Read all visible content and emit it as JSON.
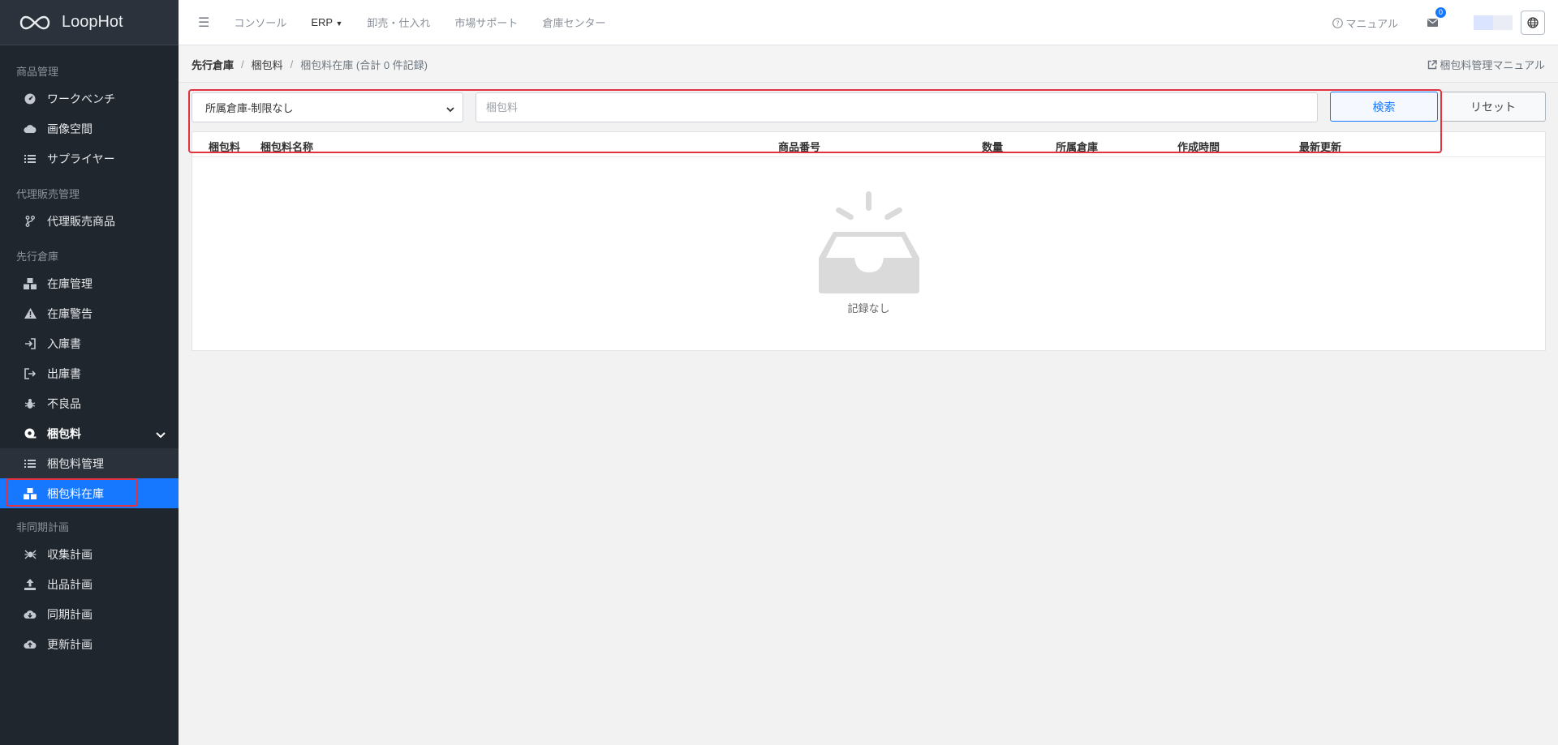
{
  "brand": {
    "name": "LoopHot"
  },
  "sidebar": {
    "sections": [
      {
        "header": "商品管理",
        "items": [
          {
            "label": "ワークベンチ",
            "icon": "dashboard-icon"
          },
          {
            "label": "画像空間",
            "icon": "cloud-icon"
          },
          {
            "label": "サプライヤー",
            "icon": "list-icon"
          }
        ]
      },
      {
        "header": "代理販売管理",
        "items": [
          {
            "label": "代理販売商品",
            "icon": "branch-icon"
          }
        ]
      },
      {
        "header": "先行倉庫",
        "items": [
          {
            "label": "在庫管理",
            "icon": "boxes-icon"
          },
          {
            "label": "在庫警告",
            "icon": "warning-icon"
          },
          {
            "label": "入庫書",
            "icon": "sign-in-icon"
          },
          {
            "label": "出庫書",
            "icon": "sign-out-icon"
          },
          {
            "label": "不良品",
            "icon": "bug-icon"
          },
          {
            "label": "梱包料",
            "icon": "tape-icon"
          }
        ]
      },
      {
        "packaging_sub": [
          {
            "label": "梱包料管理",
            "icon": "list-icon"
          },
          {
            "label": "梱包料在庫",
            "icon": "boxes-icon"
          }
        ]
      },
      {
        "header": "非同期計画",
        "items": [
          {
            "label": "収集計画",
            "icon": "spider-icon"
          },
          {
            "label": "出品計画",
            "icon": "upload-icon"
          },
          {
            "label": "同期計画",
            "icon": "cloud-download-icon"
          },
          {
            "label": "更新計画",
            "icon": "cloud-upload-icon"
          }
        ]
      }
    ]
  },
  "topbar": {
    "links": [
      "コンソール",
      "ERP",
      "卸売・仕入れ",
      "市場サポート",
      "倉庫センター"
    ],
    "manual": "マニュアル",
    "mail_count": "0"
  },
  "breadcrumb": {
    "items": [
      "先行倉庫",
      "梱包料",
      "梱包料在庫 (合計 0 件記録)"
    ],
    "right_link": "梱包料管理マニュアル"
  },
  "filters": {
    "warehouse_select": "所属倉庫-制限なし",
    "packaging_placeholder": "梱包料",
    "search_label": "検索",
    "reset_label": "リセット"
  },
  "table": {
    "columns": [
      "梱包料",
      "梱包料名称",
      "商品番号",
      "数量",
      "所属倉庫",
      "作成時間",
      "最新更新"
    ],
    "empty_text": "記録なし"
  },
  "colors": {
    "accent": "#1677ff",
    "sidebar_bg": "#20262e",
    "highlight": "#e0333f"
  }
}
